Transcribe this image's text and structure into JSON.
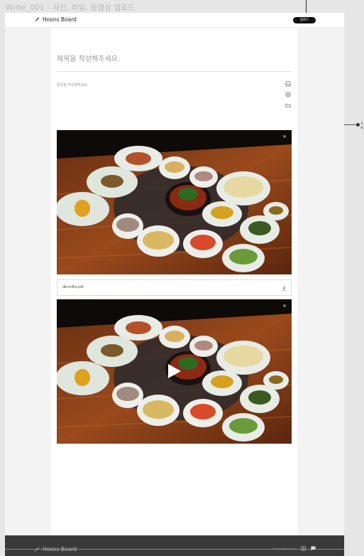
{
  "frame_label": "Write_001 - 사진, 파일, 동영상 업로드",
  "annotation_text": "삭제",
  "header": {
    "logo_icon": "feather-pen-icon",
    "logo_text": "Hoons Board",
    "upload_label": "업로드"
  },
  "editor": {
    "title_placeholder": "제목을 작성해주세요.",
    "body_placeholder": "본문을 작성해주세요.",
    "tools": [
      "image-upload-icon",
      "video-upload-icon",
      "file-upload-icon"
    ]
  },
  "attachments": {
    "image": {
      "type": "image",
      "alt": "Korean table setting photo",
      "remove_icon": "close-icon"
    },
    "file": {
      "name": "dknrxfks.pdf",
      "download_icon": "download-icon"
    },
    "video": {
      "type": "video",
      "play_icon": "play-icon",
      "remove_icon": "close-icon"
    }
  },
  "footer": {
    "logo_text": "Hoons Board",
    "email": "admin@gmail.com",
    "icons": [
      "instagram-icon",
      "chat-icon"
    ]
  }
}
